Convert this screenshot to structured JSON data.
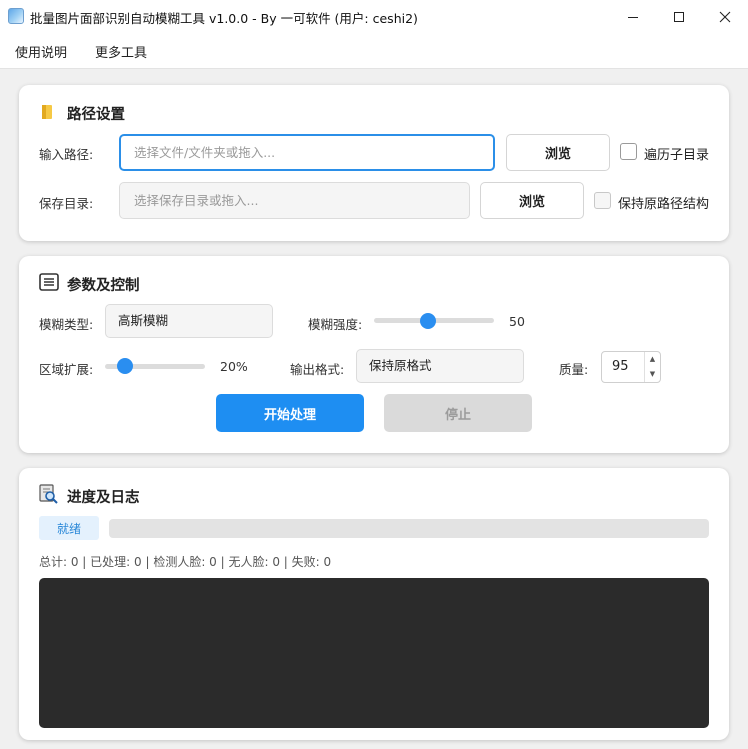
{
  "window": {
    "title": "批量图片面部识别自动模糊工具 v1.0.0 - By 一可软件 (用户: ceshi2)",
    "controls": {
      "minimize": "minimize-icon",
      "maximize": "maximize-icon",
      "close": "close-icon"
    }
  },
  "menu": {
    "items": [
      "使用说明",
      "更多工具"
    ]
  },
  "path_section": {
    "title": "路径设置",
    "icon": "folder-icon",
    "input_label": "输入路径:",
    "input_placeholder": "选择文件/文件夹或拖入...",
    "input_value": "",
    "browse_label": "浏览",
    "recursive_label": "遍历子目录",
    "recursive_checked": false,
    "save_label": "保存目录:",
    "save_placeholder": "选择保存目录或拖入...",
    "save_value": "",
    "save_browse_label": "浏览",
    "keep_structure_label": "保持原路径结构",
    "keep_structure_checked": false
  },
  "params_section": {
    "title": "参数及控制",
    "icon": "list-icon",
    "blur_type_label": "模糊类型:",
    "blur_type_value": "高斯模糊",
    "blur_strength_label": "模糊强度:",
    "blur_strength_value": "50",
    "blur_strength_fraction": 0.45,
    "expand_label": "区域扩展:",
    "expand_value": "20%",
    "expand_fraction": 0.2,
    "format_label": "输出格式:",
    "format_value": "保持原格式",
    "quality_label": "质量:",
    "quality_value": "95",
    "start_label": "开始处理",
    "stop_label": "停止"
  },
  "progress_section": {
    "title": "进度及日志",
    "icon": "search-document-icon",
    "status": "就绪",
    "progress": 0,
    "stats": "总计: 0 | 已处理: 0 | 检测人脸: 0 | 无人脸: 0 | 失败: 0",
    "log": ""
  },
  "colors": {
    "accent": "#1e8ef2",
    "focus_border": "#2b8fe8",
    "disabled": "#dadada",
    "log_background": "#2b2b2b"
  }
}
